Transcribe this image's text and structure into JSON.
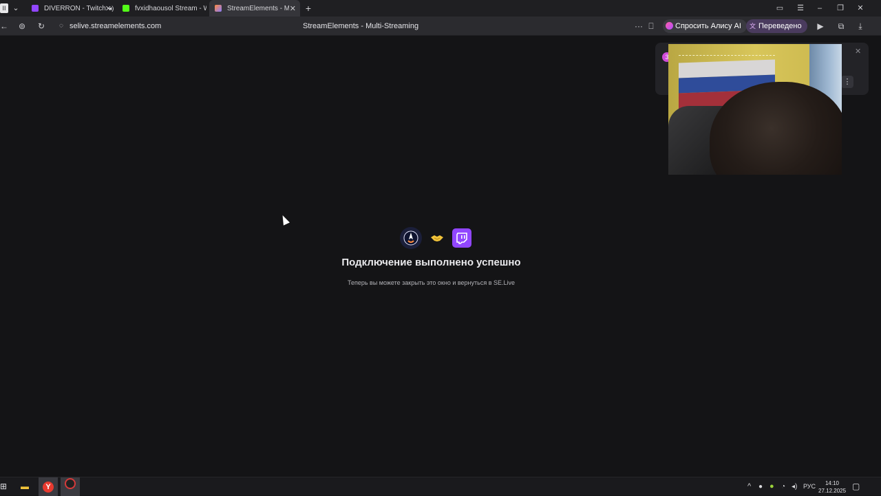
{
  "tabs": [
    {
      "title": "DIVERRON - Twitch",
      "icon": "twitch-favicon",
      "color": "#9146ff",
      "muted_icon": "speaker-icon"
    },
    {
      "title": "fvxidhaousol Stream - Wa",
      "icon": "kick-favicon",
      "color": "#53fc18"
    },
    {
      "title": "StreamElements - Multi",
      "icon": "streamelements-favicon",
      "color": "#8a7cff",
      "active": true
    }
  ],
  "address": {
    "url": "selive.streamelements.com",
    "page_title": "StreamElements - Multi-Streaming",
    "alice_label": "Спросить Алису AI",
    "translated_label": "Переведено"
  },
  "main": {
    "title": "Подключение выполнено успешно",
    "subtitle": "Теперь вы можете закрыть это окно и вернуться в SE.Live"
  },
  "pip": {
    "badge": "3"
  },
  "taskbar": {
    "lang": "РУС",
    "time": "14:10",
    "date": "27.12.2025"
  },
  "colors": {
    "background": "#141416",
    "twitch": "#9146ff",
    "accent_pink": "#ff5ca8"
  }
}
